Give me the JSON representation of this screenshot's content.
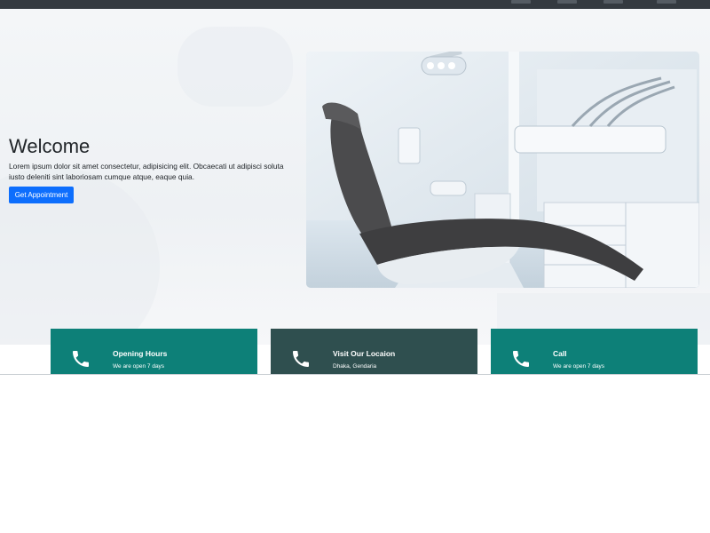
{
  "hero": {
    "title": "Welcome",
    "description": "Lorem ipsum dolor sit amet consectetur, adipisicing elit. Obcaecati ut adipisci soluta iusto deleniti sint laboriosam cumque atque, eaque quia.",
    "button_label": "Get Appointment",
    "button_color": "#0d6efd"
  },
  "cards": [
    {
      "icon": "phone-icon",
      "title": "Opening Hours",
      "subtitle": "We are open 7 days",
      "color": "#0d8078"
    },
    {
      "icon": "phone-icon",
      "title": "Visit Our Locaion",
      "subtitle": "Dhaka, Gendaria",
      "color": "#2f4f4f"
    },
    {
      "icon": "phone-icon",
      "title": "Call",
      "subtitle": "We are open 7 days",
      "color": "#0d8078"
    }
  ],
  "colors": {
    "navbar": "#343a40",
    "teal": "#0d8078",
    "dark_slate": "#2f4f4f"
  }
}
